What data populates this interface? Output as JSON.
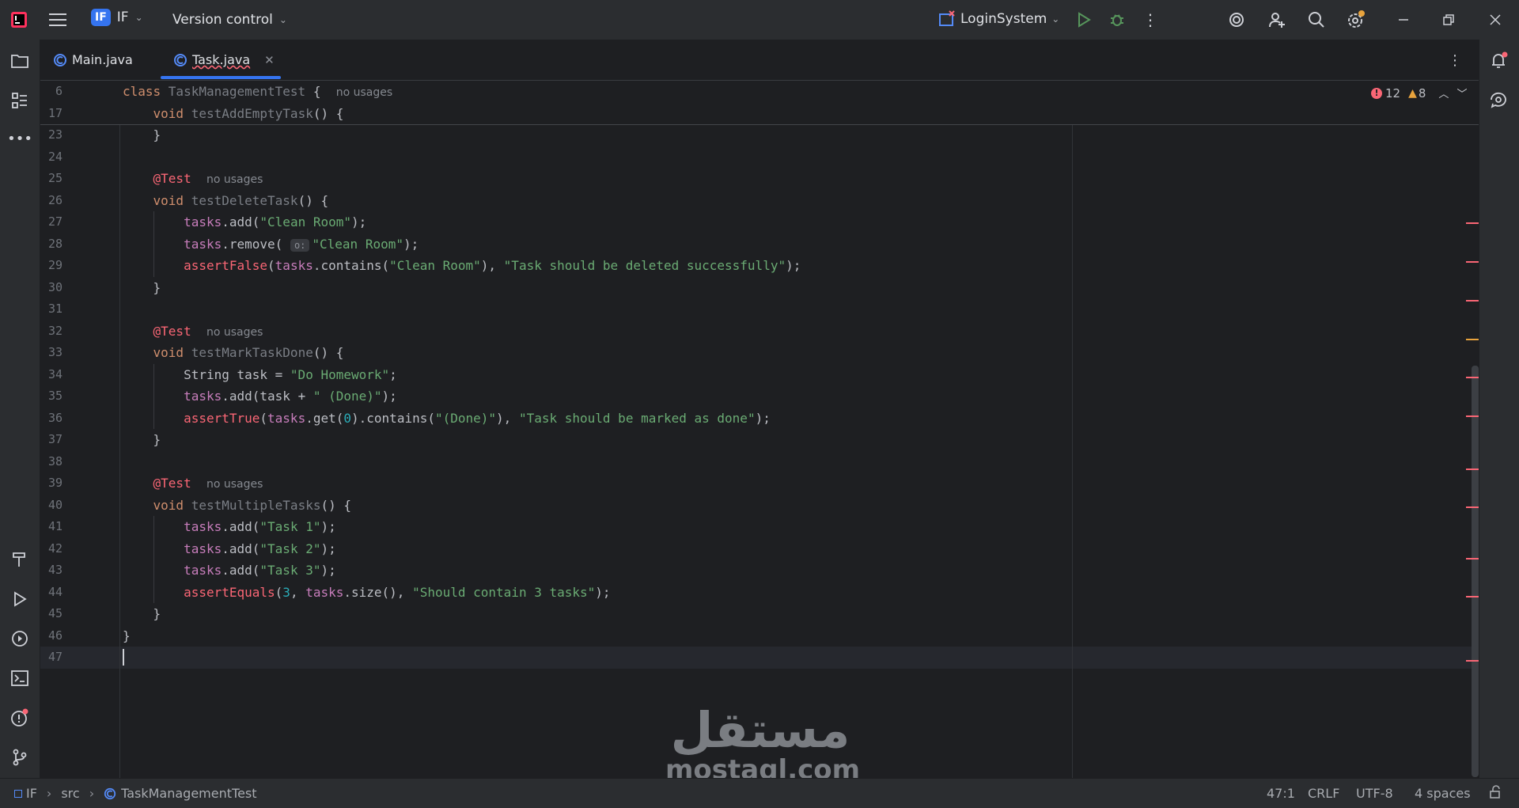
{
  "titlebar": {
    "project_badge": "IF",
    "project_name": "IF",
    "vcs_label": "Version control",
    "run_config": "LoginSystem"
  },
  "tabs": [
    {
      "label": "Main.java",
      "active": false
    },
    {
      "label": "Task.java",
      "active": true
    }
  ],
  "editor": {
    "sticky": [
      {
        "num": "6",
        "tokens": [
          [
            "kw",
            "class "
          ],
          [
            "cls",
            "TaskManagementTest"
          ],
          [
            "plain",
            " {  "
          ],
          [
            "hint",
            "no usages"
          ]
        ]
      },
      {
        "num": "17",
        "tokens": [
          [
            "plain",
            "    "
          ],
          [
            "kw",
            "void "
          ],
          [
            "fnd",
            "testAddEmptyTask"
          ],
          [
            "plain",
            "() {"
          ]
        ]
      }
    ],
    "lines": [
      {
        "num": "23",
        "tokens": [
          [
            "plain",
            "    }"
          ]
        ]
      },
      {
        "num": "24",
        "tokens": []
      },
      {
        "num": "25",
        "tokens": [
          [
            "plain",
            "    "
          ],
          [
            "err",
            "@Test"
          ],
          [
            "plain",
            "  "
          ],
          [
            "hint",
            "no usages"
          ]
        ]
      },
      {
        "num": "26",
        "tokens": [
          [
            "plain",
            "    "
          ],
          [
            "kw",
            "void "
          ],
          [
            "fnd",
            "testDeleteTask"
          ],
          [
            "plain",
            "() {"
          ]
        ]
      },
      {
        "num": "27",
        "tokens": [
          [
            "plain",
            "        "
          ],
          [
            "fld",
            "tasks"
          ],
          [
            "plain",
            ".add("
          ],
          [
            "str",
            "\"Clean Room\""
          ],
          [
            "plain",
            ");"
          ]
        ]
      },
      {
        "num": "28",
        "tokens": [
          [
            "plain",
            "        "
          ],
          [
            "fld",
            "tasks"
          ],
          [
            "plain",
            ".remove( "
          ],
          [
            "pill",
            "o:"
          ],
          [
            "str",
            "\"Clean Room\""
          ],
          [
            "plain",
            ");"
          ]
        ]
      },
      {
        "num": "29",
        "tokens": [
          [
            "plain",
            "        "
          ],
          [
            "err",
            "assertFalse"
          ],
          [
            "plain",
            "("
          ],
          [
            "fld",
            "tasks"
          ],
          [
            "plain",
            ".contains("
          ],
          [
            "str",
            "\"Clean Room\""
          ],
          [
            "plain",
            "), "
          ],
          [
            "str",
            "\"Task should be deleted successfully\""
          ],
          [
            "plain",
            ");"
          ]
        ]
      },
      {
        "num": "30",
        "tokens": [
          [
            "plain",
            "    }"
          ]
        ]
      },
      {
        "num": "31",
        "tokens": []
      },
      {
        "num": "32",
        "tokens": [
          [
            "plain",
            "    "
          ],
          [
            "err",
            "@Test"
          ],
          [
            "plain",
            "  "
          ],
          [
            "hint",
            "no usages"
          ]
        ]
      },
      {
        "num": "33",
        "tokens": [
          [
            "plain",
            "    "
          ],
          [
            "kw",
            "void "
          ],
          [
            "fnd",
            "testMarkTaskDone"
          ],
          [
            "plain",
            "() {"
          ]
        ]
      },
      {
        "num": "34",
        "tokens": [
          [
            "plain",
            "        String task = "
          ],
          [
            "str",
            "\"Do Homework\""
          ],
          [
            "plain",
            ";"
          ]
        ]
      },
      {
        "num": "35",
        "tokens": [
          [
            "plain",
            "        "
          ],
          [
            "fld",
            "tasks"
          ],
          [
            "plain",
            ".add(task + "
          ],
          [
            "str",
            "\" (Done)\""
          ],
          [
            "plain",
            ");"
          ]
        ]
      },
      {
        "num": "36",
        "tokens": [
          [
            "plain",
            "        "
          ],
          [
            "err",
            "assertTrue"
          ],
          [
            "plain",
            "("
          ],
          [
            "fld",
            "tasks"
          ],
          [
            "plain",
            ".get("
          ],
          [
            "num",
            "0"
          ],
          [
            "plain",
            ").contains("
          ],
          [
            "str",
            "\"(Done)\""
          ],
          [
            "plain",
            "), "
          ],
          [
            "str",
            "\"Task should be marked as done\""
          ],
          [
            "plain",
            ");"
          ]
        ]
      },
      {
        "num": "37",
        "tokens": [
          [
            "plain",
            "    }"
          ]
        ]
      },
      {
        "num": "38",
        "tokens": []
      },
      {
        "num": "39",
        "tokens": [
          [
            "plain",
            "    "
          ],
          [
            "err",
            "@Test"
          ],
          [
            "plain",
            "  "
          ],
          [
            "hint",
            "no usages"
          ]
        ]
      },
      {
        "num": "40",
        "tokens": [
          [
            "plain",
            "    "
          ],
          [
            "kw",
            "void "
          ],
          [
            "fnd",
            "testMultipleTasks"
          ],
          [
            "plain",
            "() {"
          ]
        ]
      },
      {
        "num": "41",
        "tokens": [
          [
            "plain",
            "        "
          ],
          [
            "fld",
            "tasks"
          ],
          [
            "plain",
            ".add("
          ],
          [
            "str",
            "\"Task 1\""
          ],
          [
            "plain",
            ");"
          ]
        ]
      },
      {
        "num": "42",
        "tokens": [
          [
            "plain",
            "        "
          ],
          [
            "fld",
            "tasks"
          ],
          [
            "plain",
            ".add("
          ],
          [
            "str",
            "\"Task 2\""
          ],
          [
            "plain",
            ");"
          ]
        ]
      },
      {
        "num": "43",
        "tokens": [
          [
            "plain",
            "        "
          ],
          [
            "fld",
            "tasks"
          ],
          [
            "plain",
            ".add("
          ],
          [
            "str",
            "\"Task 3\""
          ],
          [
            "plain",
            ");"
          ]
        ]
      },
      {
        "num": "44",
        "tokens": [
          [
            "plain",
            "        "
          ],
          [
            "err",
            "assertEquals"
          ],
          [
            "plain",
            "("
          ],
          [
            "num",
            "3"
          ],
          [
            "plain",
            ", "
          ],
          [
            "fld",
            "tasks"
          ],
          [
            "plain",
            ".size(), "
          ],
          [
            "str",
            "\"Should contain 3 tasks\""
          ],
          [
            "plain",
            ");"
          ]
        ]
      },
      {
        "num": "45",
        "tokens": [
          [
            "plain",
            "    }"
          ]
        ]
      },
      {
        "num": "46",
        "tokens": [
          [
            "plain",
            "}"
          ]
        ]
      },
      {
        "num": "47",
        "tokens": []
      }
    ],
    "error_count": "12",
    "warning_count": "8"
  },
  "statusbar": {
    "crumb_project": "IF",
    "crumb_src": "src",
    "crumb_class": "TaskManagementTest",
    "position": "47:1",
    "line_sep": "CRLF",
    "encoding": "UTF-8",
    "indent": "4 spaces"
  },
  "watermark": {
    "arabic": "مستقل",
    "latin": "mostaql.com"
  },
  "colors": {
    "background": "#1e1f22",
    "panel": "#2b2d30",
    "error": "#fa6675",
    "warning": "#e8a33d",
    "accent": "#3574f0"
  }
}
